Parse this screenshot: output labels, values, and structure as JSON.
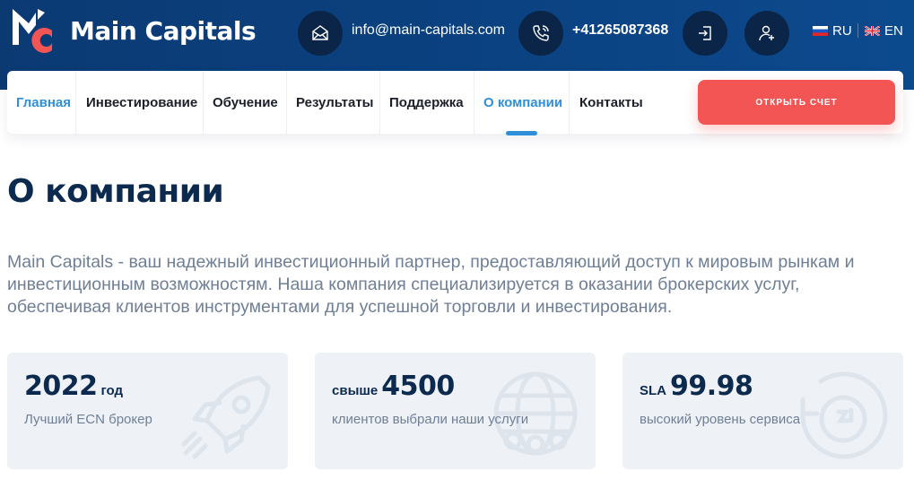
{
  "brand": {
    "name": "Main Capitals",
    "logo_letters": "MC"
  },
  "contact": {
    "email": "info@main-capitals.com",
    "phone": "+41265087368"
  },
  "icons": {
    "mail": "envelope-icon",
    "phone": "phone-icon",
    "login": "login-icon",
    "register": "add-user-icon",
    "ru_flag": "russia-flag-icon",
    "en_flag": "uk-flag-icon"
  },
  "languages": [
    {
      "code": "RU"
    },
    {
      "code": "EN"
    }
  ],
  "nav": {
    "items": [
      {
        "label": "Главная",
        "active": true
      },
      {
        "label": "Инвестирование"
      },
      {
        "label": "Обучение"
      },
      {
        "label": "Результаты"
      },
      {
        "label": "Поддержка"
      },
      {
        "label": "О компании",
        "active": true,
        "current": true
      },
      {
        "label": "Контакты"
      }
    ],
    "cta_label": "ОТКРЫТЬ СЧЕТ"
  },
  "page": {
    "title": "О компании",
    "intro": "Main Capitals - ваш надежный инвестиционный партнер, предоставляющий доступ к мировым рынкам и инвестиционным возможностям. Наша компания специализируется в оказании брокерских услуг, обеспечивая клиентов инструментами для успешной торговли и инвестирования."
  },
  "stats": [
    {
      "value": "2022",
      "suffix": "год",
      "prefix": "",
      "desc": "Лучший ECN брокер",
      "icon": "rocket-icon"
    },
    {
      "value": "4500",
      "prefix": "свыше",
      "suffix": "",
      "desc": "клиентов выбрали наши услуги",
      "icon": "globe-users-icon"
    },
    {
      "value": "99.98",
      "prefix": "SLA",
      "suffix": "",
      "desc": "высокий уровень сервиса",
      "icon": "24-hours-icon"
    }
  ],
  "colors": {
    "header_bg": "#0b4180",
    "accent_blue": "#2f8fd8",
    "cta_red": "#f35454",
    "title_navy": "#0c2a4e",
    "text_muted": "#6f7f95",
    "card_bg": "#eef2f6"
  }
}
